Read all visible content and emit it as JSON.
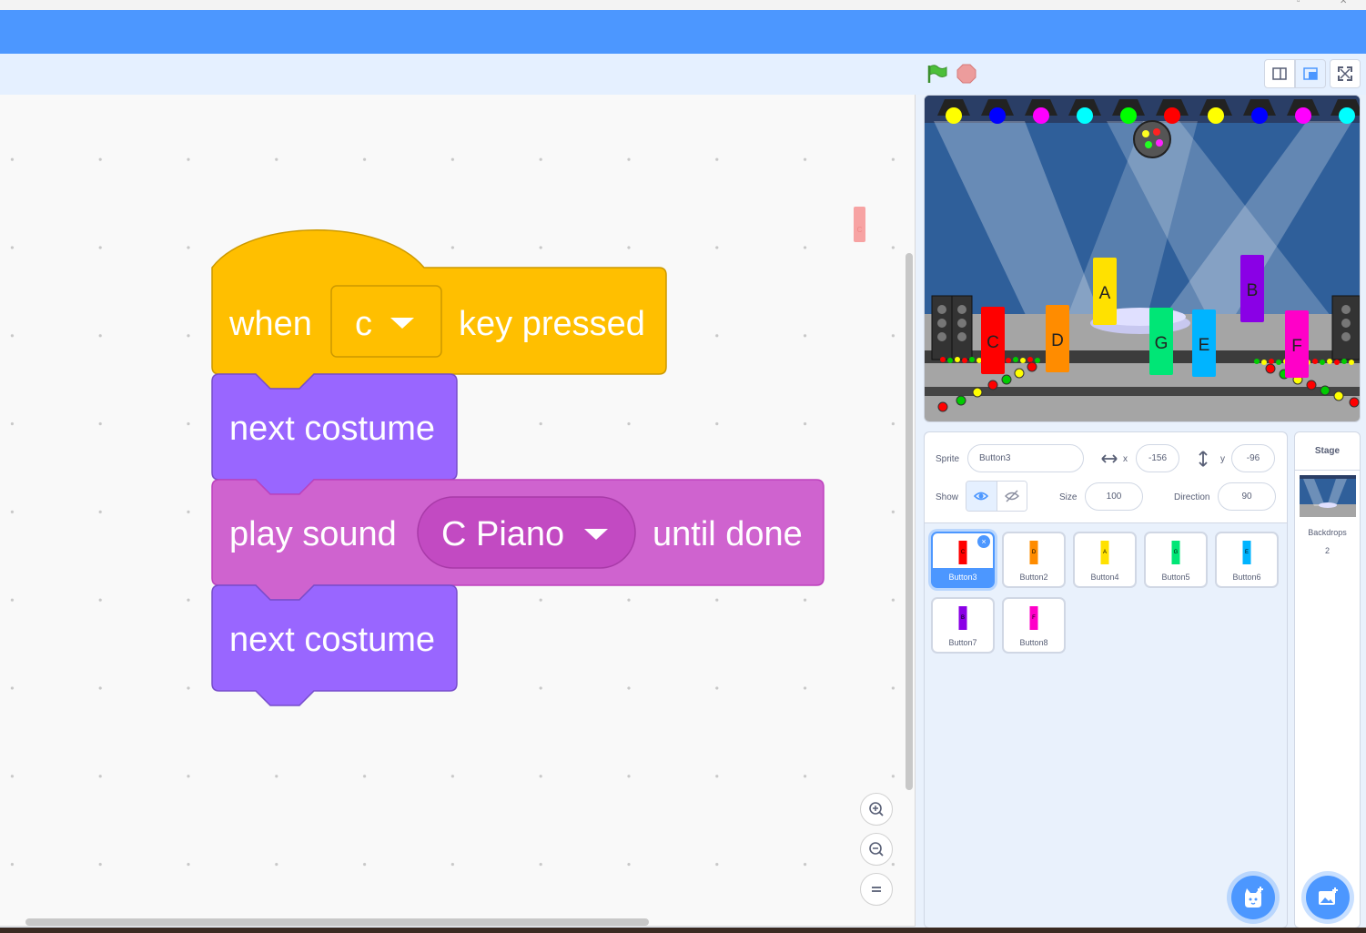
{
  "colors": {
    "menu_blue": "#4c97ff",
    "events_yellow": "#ffbf00",
    "looks_purple": "#9966ff",
    "sound_magenta": "#cf63cf"
  },
  "code": {
    "hat": {
      "when": "when",
      "key": "c",
      "suffix": "key pressed"
    },
    "block1": "next costume",
    "sound": {
      "prefix": "play sound",
      "sound_name": "C Piano",
      "suffix": "until done"
    },
    "block3": "next costume"
  },
  "stage_sprites": [
    {
      "letter": "C",
      "color": "#ff0000"
    },
    {
      "letter": "D",
      "color": "#ff8c00"
    },
    {
      "letter": "A",
      "color": "#ffe100"
    },
    {
      "letter": "G",
      "color": "#00e676"
    },
    {
      "letter": "E",
      "color": "#00b4ff"
    },
    {
      "letter": "B",
      "color": "#8a00e6"
    },
    {
      "letter": "F",
      "color": "#ff00c8"
    }
  ],
  "sprite_info": {
    "sprite_label": "Sprite",
    "sprite_name": "Button3",
    "x_label": "x",
    "x_value": "-156",
    "y_label": "y",
    "y_value": "-96",
    "show_label": "Show",
    "size_label": "Size",
    "size_value": "100",
    "direction_label": "Direction",
    "direction_value": "90"
  },
  "sprites": [
    {
      "name": "Button3",
      "color": "#ff0000",
      "letter": "C",
      "selected": true
    },
    {
      "name": "Button2",
      "color": "#ff8c00",
      "letter": "D"
    },
    {
      "name": "Button4",
      "color": "#ffe100",
      "letter": "A"
    },
    {
      "name": "Button5",
      "color": "#00e676",
      "letter": "G"
    },
    {
      "name": "Button6",
      "color": "#00b4ff",
      "letter": "E"
    },
    {
      "name": "Button7",
      "color": "#8a00e6",
      "letter": "B"
    },
    {
      "name": "Button8",
      "color": "#ff00c8",
      "letter": "F"
    }
  ],
  "stage_panel": {
    "title": "Stage",
    "backdrops_label": "Backdrops",
    "backdrops_count": "2"
  },
  "corner_tag": "C"
}
